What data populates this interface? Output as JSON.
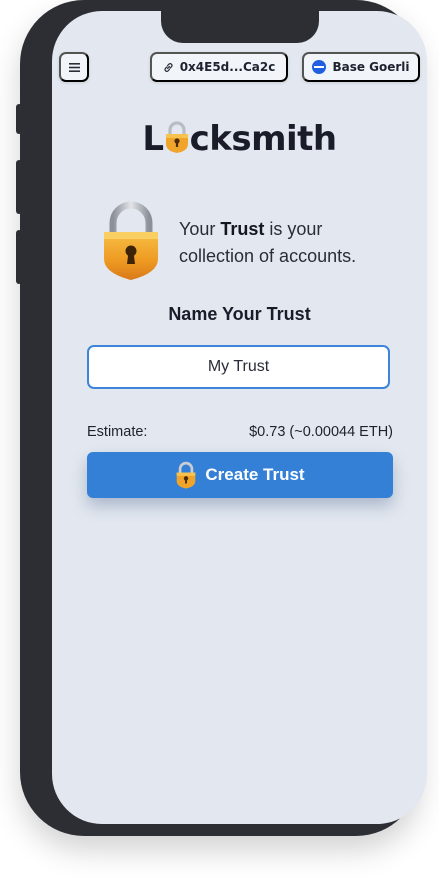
{
  "header": {
    "account_address": "0x4E5d...Ca2c",
    "network_name": "Base Goerli",
    "network_color": "#1f5fe0"
  },
  "brand": {
    "logo_before": "L",
    "logo_after": "cksmith"
  },
  "intro": {
    "prefix": "Your ",
    "emphasis": "Trust",
    "suffix": " is your collection of accounts."
  },
  "form": {
    "title": "Name Your Trust",
    "trust_name_value": "My Trust",
    "estimate_label": "Estimate:",
    "estimate_value": "$0.73 (~0.00044 ETH)",
    "create_button_label": "Create Trust"
  },
  "icons": {
    "menu": "hamburger-menu-icon",
    "link": "link-icon",
    "network": "base-network-icon",
    "lock": "padlock-icon"
  },
  "colors": {
    "accent": "#3380d6",
    "lock_gold": "#f0a52a",
    "screen_bg": "#e3e8f0"
  }
}
